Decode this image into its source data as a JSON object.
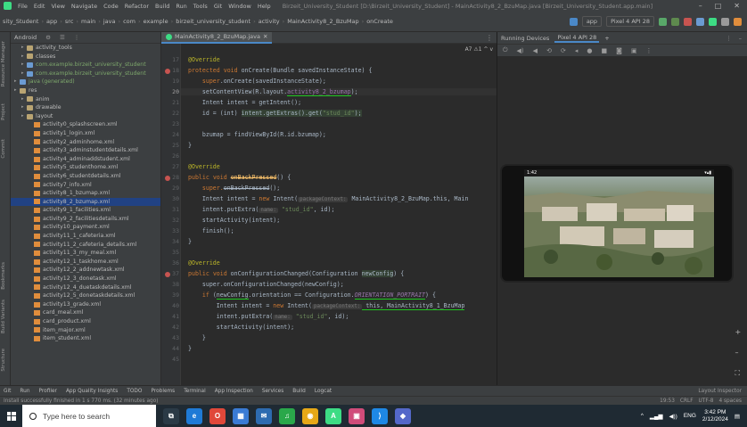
{
  "titlebar": {
    "menu": [
      "File",
      "Edit",
      "View",
      "Navigate",
      "Code",
      "Refactor",
      "Build",
      "Run",
      "Tools",
      "Git",
      "Window",
      "Help"
    ],
    "window_title": "Birzeit_University_Student [D:\\Birzeit_University_Student] - MainActivity8_2_BzuMap.java [Birzeit_University_Student.app.main]"
  },
  "navbar": {
    "crumbs": [
      "sity_Student",
      "app",
      "src",
      "main",
      "java",
      "com",
      "example",
      "birzeit_university_student",
      "activity",
      "MainActivity8_2_BzuMap",
      "onCreate"
    ],
    "run_config": "app",
    "device": "Pixel 4 API 28"
  },
  "project": {
    "view_label": "Android",
    "items": [
      {
        "label": "activity_tools",
        "type": "folder",
        "indent": 1
      },
      {
        "label": "classes",
        "type": "folder",
        "indent": 1
      },
      {
        "label": "com.example.birzeit_university_student",
        "type": "pkg",
        "indent": 1
      },
      {
        "label": "com.example.birzeit_university_student",
        "type": "pkg",
        "indent": 1
      },
      {
        "label": "java (generated)",
        "type": "pkg",
        "indent": 0
      },
      {
        "label": "res",
        "type": "folder",
        "indent": 0
      },
      {
        "label": "anim",
        "type": "folder",
        "indent": 1
      },
      {
        "label": "drawable",
        "type": "folder",
        "indent": 1
      },
      {
        "label": "layout",
        "type": "folder",
        "indent": 1
      },
      {
        "label": "activity0_splashscreen.xml",
        "type": "xml",
        "indent": 2
      },
      {
        "label": "activity1_login.xml",
        "type": "xml",
        "indent": 2
      },
      {
        "label": "activity2_adminhome.xml",
        "type": "xml",
        "indent": 2
      },
      {
        "label": "activity3_adminstudentdetails.xml",
        "type": "xml",
        "indent": 2
      },
      {
        "label": "activity4_adminaddstudent.xml",
        "type": "xml",
        "indent": 2
      },
      {
        "label": "activity5_studenthome.xml",
        "type": "xml",
        "indent": 2
      },
      {
        "label": "activity6_studentdetails.xml",
        "type": "xml",
        "indent": 2
      },
      {
        "label": "activity7_info.xml",
        "type": "xml",
        "indent": 2
      },
      {
        "label": "activity8_1_bzumap.xml",
        "type": "xml",
        "indent": 2
      },
      {
        "label": "activity8_2_bzumap.xml",
        "type": "xml",
        "indent": 2
      },
      {
        "label": "activity9_1_facilities.xml",
        "type": "xml",
        "indent": 2
      },
      {
        "label": "activity9_2_facilitiesdetails.xml",
        "type": "xml",
        "indent": 2
      },
      {
        "label": "activity10_payment.xml",
        "type": "xml",
        "indent": 2
      },
      {
        "label": "activity11_1_cafeteria.xml",
        "type": "xml",
        "indent": 2
      },
      {
        "label": "activity11_2_cafeteria_details.xml",
        "type": "xml",
        "indent": 2
      },
      {
        "label": "activity11_3_my_meal.xml",
        "type": "xml",
        "indent": 2
      },
      {
        "label": "activity12_1_taskhome.xml",
        "type": "xml",
        "indent": 2
      },
      {
        "label": "activity12_2_addnewtask.xml",
        "type": "xml",
        "indent": 2
      },
      {
        "label": "activity12_3_donetask.xml",
        "type": "xml",
        "indent": 2
      },
      {
        "label": "activity12_4_duetaskdetails.xml",
        "type": "xml",
        "indent": 2
      },
      {
        "label": "activity12_5_donetaskdetails.xml",
        "type": "xml",
        "indent": 2
      },
      {
        "label": "activity13_grade.xml",
        "type": "xml",
        "indent": 2
      },
      {
        "label": "card_meal.xml",
        "type": "xml",
        "indent": 2
      },
      {
        "label": "card_product.xml",
        "type": "xml",
        "indent": 2
      },
      {
        "label": "item_major.xml",
        "type": "xml",
        "indent": 2
      },
      {
        "label": "item_student.xml",
        "type": "xml",
        "indent": 2
      }
    ]
  },
  "left_strip": {
    "tabs": [
      "Resource Manager",
      "Project",
      "Commit",
      "Bookmarks",
      "Build Variants",
      "Structure"
    ]
  },
  "editor": {
    "tab_label": "MainActivity8_2_BzuMap.java",
    "inspect_badge": "A7 ⚠1 ^ v",
    "line_numbers": [
      17,
      18,
      19,
      20,
      21,
      22,
      23,
      24,
      25,
      26,
      27,
      28,
      29,
      30,
      31,
      32,
      33,
      34,
      35,
      36,
      37,
      38,
      39,
      40,
      41,
      42,
      43,
      44,
      45
    ],
    "tokens": {
      "override": "@Override",
      "protected": "protected",
      "public": "public",
      "void": "void",
      "new": "new",
      "int": "int",
      "if": "if",
      "sig_oncreate": " onCreate(Bundle savedInstanceState) {",
      "super_oncreate": "super",
      "oncreate_call": ".onCreate(savedInstanceState);",
      "setcontent": "setContentView(R.layout.",
      "layout_name": "activity8_2_bzumap",
      "setcontent_end": ");",
      "intent_decl": "Intent intent = getIntent();",
      "id_assign": "id = (int) ",
      "get_extras": "intent.getExtras().get(",
      "stud_id": "\"stud_id\"",
      "get_extras_end": ");",
      "bzumap_find": "bzumap = findViewById(R.id.bzumap);",
      "close_brace": "}",
      "on_back": "onBackPressed",
      "sig_back_end": "() {",
      "super_back": "super.",
      "super_back_end": "();",
      "intent_new": "Intent intent = ",
      "intent_ctor": " Intent(",
      "hint_pkg": "packageContext:",
      "intent_args": " MainActivity8_2_BzuMap.this, Main",
      "put_extra": "intent.putExtra(",
      "hint_name": "name:",
      "put_extra_args": ", id);",
      "start_activity": "startActivity(intent);",
      "finish": "finish();",
      "sig_config": " onConfigurationChanged(Configuration ",
      "new_config": "newConfig",
      "sig_config_end": ") {",
      "super_config": "super.onConfigurationChanged(newConfig);",
      "if_paren": " (",
      "if_orientation": ".orientation == Configuration.",
      "portrait": "ORIENTATION_PORTRAIT",
      "if_end": ") {",
      "intent_new2": "Intent intent = ",
      "this_main81": " this, MainActivity8_1_BzuMap"
    }
  },
  "devices": {
    "header_label": "Running Devices",
    "device_tab": "Pixel 4 API 28",
    "phone_time": "1:42",
    "phone_battery": "▾▴▮"
  },
  "toolwin": {
    "items": [
      "Git",
      "Run",
      "Profiler",
      "App Quality Insights",
      "TODO",
      "Problems",
      "Terminal",
      "App Inspection",
      "Services",
      "Build",
      "Logcat"
    ],
    "right": "Layout Inspector"
  },
  "statusbar": {
    "message": "Install successfully finished in 1 s 770 ms. (32 minutes ago)",
    "position": "19:53",
    "line_sep": "CRLF",
    "encoding": "UTF-8",
    "indent": "4 spaces"
  },
  "taskbar": {
    "search_placeholder": "Type here to search",
    "lang": "ENG",
    "time": "3:42 PM",
    "date": "2/12/2024"
  },
  "colors": {
    "android_green": "#3ddc84",
    "selection": "#214283",
    "editor_bg": "#2b2b2b",
    "panel_bg": "#3c3f41",
    "underline_annotation": "#1ec71e"
  }
}
